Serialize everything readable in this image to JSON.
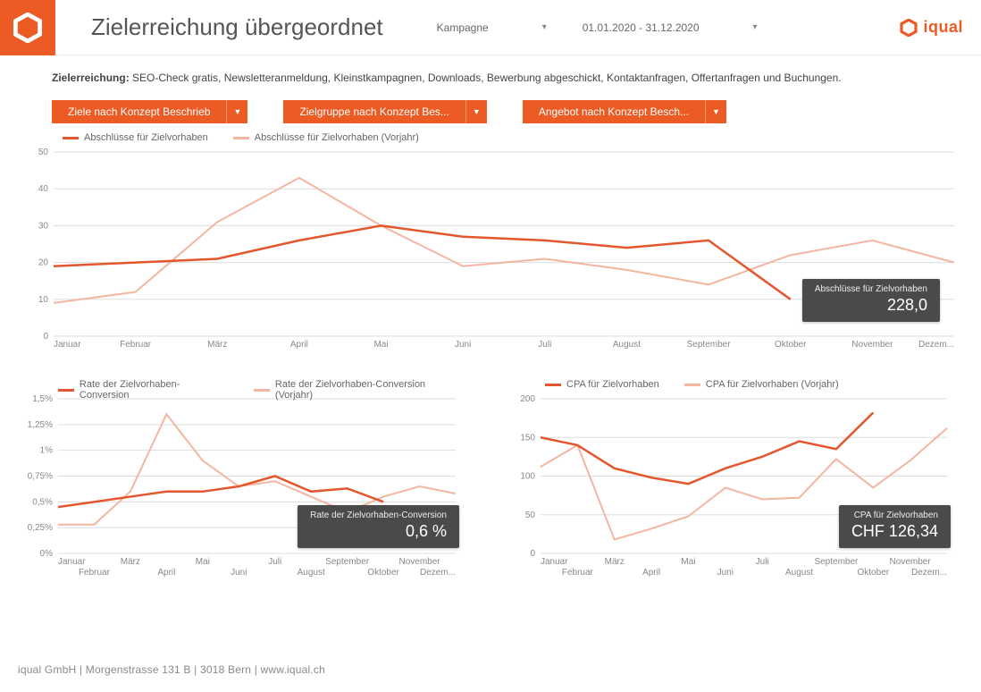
{
  "header": {
    "title": "Zielerreichung übergeordnet",
    "selector1_label": "Kampagne",
    "date_range": "01.01.2020 - 31.12.2020",
    "brand": "iqual"
  },
  "description_label": "Zielerreichung:",
  "description_text": "SEO-Check gratis, Newsletteranmeldung, Kleinstkampagnen, Downloads, Bewerbung abgeschickt, Kontaktanfragen, Offertanfragen und Buchungen.",
  "buttons": {
    "b1": "Ziele nach Konzept Beschrieb",
    "b2": "Zielgruppe nach Konzept Bes...",
    "b3": "Angebot nach Konzept Besch..."
  },
  "months_full": [
    "Januar",
    "Februar",
    "März",
    "April",
    "Mai",
    "Juni",
    "Juli",
    "August",
    "September",
    "Oktober",
    "November",
    "Dezem..."
  ],
  "colors": {
    "current": "#e4572e",
    "previous": "#f4b6a0",
    "kpi_bg": "#4a4a4a"
  },
  "chart_data": [
    {
      "id": "abschluesse",
      "type": "line",
      "title": "",
      "xlabel": "",
      "ylabel": "",
      "ylim": [
        0,
        50
      ],
      "yticks": [
        0,
        10,
        20,
        30,
        40,
        50
      ],
      "categories": [
        "Januar",
        "Februar",
        "März",
        "April",
        "Mai",
        "Juni",
        "Juli",
        "August",
        "September",
        "Oktober",
        "November",
        "Dezember"
      ],
      "series": [
        {
          "name": "Abschlüsse für Zielvorhaben",
          "values": [
            19,
            20,
            21,
            26,
            30,
            27,
            26,
            24,
            26,
            10,
            null,
            null
          ]
        },
        {
          "name": "Abschlüsse für Zielvorhaben (Vorjahr)",
          "values": [
            9,
            12,
            31,
            43,
            30,
            19,
            21,
            18,
            14,
            22,
            26,
            20
          ]
        }
      ],
      "kpi": {
        "label": "Abschlüsse für Zielvorhaben",
        "value": "228,0"
      }
    },
    {
      "id": "conversion",
      "type": "line",
      "xlabel": "",
      "ylabel": "",
      "ylim": [
        0,
        1.5
      ],
      "yticks_labels": [
        "0%",
        "0,25%",
        "0,5%",
        "0,75%",
        "1%",
        "1,25%",
        "1,5%"
      ],
      "yticks": [
        0,
        0.25,
        0.5,
        0.75,
        1.0,
        1.25,
        1.5
      ],
      "categories": [
        "Januar",
        "Februar",
        "März",
        "April",
        "Mai",
        "Juni",
        "Juli",
        "August",
        "September",
        "Oktober",
        "November",
        "Dezember"
      ],
      "series": [
        {
          "name": "Rate der Zielvorhaben-Conversion",
          "values": [
            0.45,
            0.5,
            0.55,
            0.6,
            0.6,
            0.65,
            0.75,
            0.6,
            0.63,
            0.5,
            null,
            null
          ]
        },
        {
          "name": "Rate der Zielvorhaben-Conversion (Vorjahr)",
          "values": [
            0.28,
            0.28,
            0.6,
            1.35,
            0.9,
            0.65,
            0.7,
            0.55,
            0.4,
            0.55,
            0.65,
            0.58
          ]
        }
      ],
      "kpi": {
        "label": "Rate der Zielvorhaben-Conversion",
        "value": "0,6 %"
      }
    },
    {
      "id": "cpa",
      "type": "line",
      "xlabel": "",
      "ylabel": "",
      "ylim": [
        0,
        200
      ],
      "yticks": [
        0,
        50,
        100,
        150,
        200
      ],
      "categories": [
        "Januar",
        "Februar",
        "März",
        "April",
        "Mai",
        "Juni",
        "Juli",
        "August",
        "September",
        "Oktober",
        "November",
        "Dezember"
      ],
      "series": [
        {
          "name": "CPA für Zielvorhaben",
          "values": [
            150,
            140,
            110,
            98,
            90,
            110,
            125,
            145,
            135,
            182,
            null,
            null
          ]
        },
        {
          "name": "CPA für Zielvorhaben (Vorjahr)",
          "values": [
            112,
            140,
            18,
            32,
            48,
            85,
            70,
            72,
            122,
            85,
            120,
            162
          ]
        }
      ],
      "kpi": {
        "label": "CPA für Zielvorhaben",
        "value": "CHF 126,34"
      }
    }
  ],
  "footer": "iqual GmbH  |  Morgenstrasse 131 B  |  3018 Bern  |  www.iqual.ch"
}
